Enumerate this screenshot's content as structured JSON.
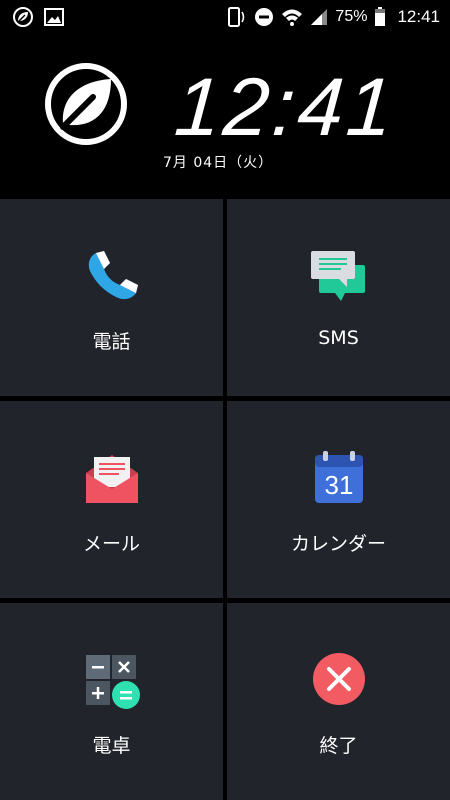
{
  "status_bar": {
    "battery_percent": "75%",
    "time": "12:41",
    "icons": [
      "leaf-app-icon",
      "image-icon",
      "phone-vibrate-icon",
      "do-not-disturb-icon",
      "wifi-icon",
      "signal-icon",
      "battery-icon"
    ]
  },
  "header": {
    "clock": "12:41",
    "date": "7月 04日（火）"
  },
  "tiles": [
    {
      "label": "電話",
      "icon": "phone-icon"
    },
    {
      "label": "SMS",
      "icon": "sms-icon"
    },
    {
      "label": "メール",
      "icon": "mail-icon"
    },
    {
      "label": "カレンダー",
      "icon": "calendar-icon",
      "icon_text": "31"
    },
    {
      "label": "電卓",
      "icon": "calculator-icon"
    },
    {
      "label": "終了",
      "icon": "exit-icon"
    }
  ],
  "colors": {
    "tile_bg": "#21242b",
    "phone_blue": "#2fa7e6",
    "sms_green": "#20c997",
    "mail_red": "#ef5361",
    "calendar_blue": "#3f6fd8",
    "calc_teal": "#2fe0b0",
    "exit_red": "#f25b62"
  }
}
